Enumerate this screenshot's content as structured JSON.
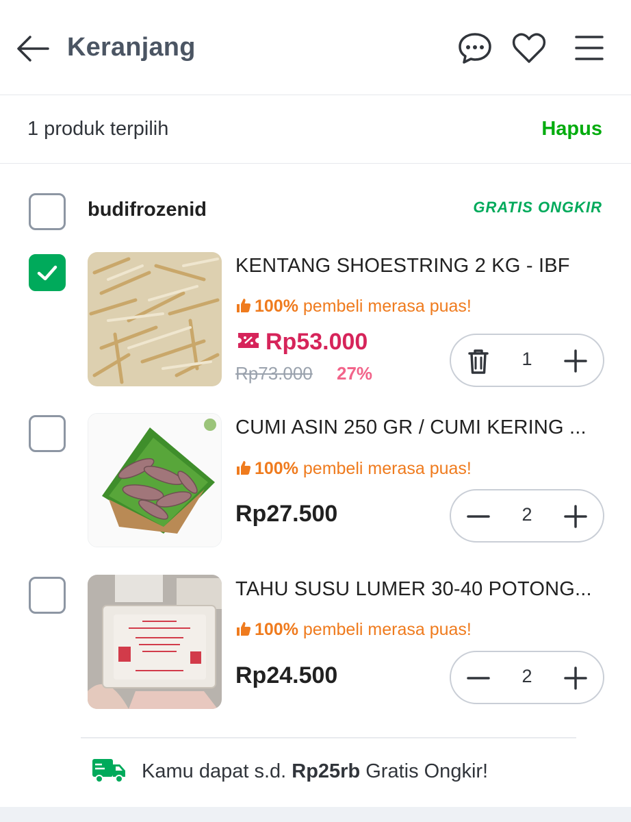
{
  "header": {
    "title": "Keranjang",
    "icons": [
      "back-arrow-icon",
      "chat-icon",
      "heart-icon",
      "menu-icon"
    ]
  },
  "selection": {
    "text": "1 produk terpilih",
    "delete_label": "Hapus"
  },
  "shop": {
    "name": "budifrozenid",
    "badge": "GRATIS ONGKIR",
    "selected": false
  },
  "items": [
    {
      "name": "KENTANG SHOESTRING 2 KG - IBF",
      "satisfaction_pct": "100%",
      "satisfaction_text": " pembeli merasa puas!",
      "price": "Rp53.000",
      "original_price": "Rp73.000",
      "discount": "27%",
      "quantity": "1",
      "selected": true
    },
    {
      "name": "CUMI ASIN 250 GR / CUMI KERING ...",
      "satisfaction_pct": "100%",
      "satisfaction_text": " pembeli merasa puas!",
      "price": "Rp27.500",
      "quantity": "2",
      "selected": false
    },
    {
      "name": "TAHU SUSU LUMER 30-40 POTONG...",
      "satisfaction_pct": "100%",
      "satisfaction_text": " pembeli merasa puas!",
      "price": "Rp24.500",
      "quantity": "2",
      "selected": false
    }
  ],
  "shipping": {
    "prefix": "Kamu dapat s.d. ",
    "amount": "Rp25rb",
    "suffix": " Gratis Ongkir!"
  },
  "colors": {
    "accent_green": "#03ac0e",
    "discount_red": "#d6245a",
    "satisfaction_orange": "#ef7b1e"
  }
}
